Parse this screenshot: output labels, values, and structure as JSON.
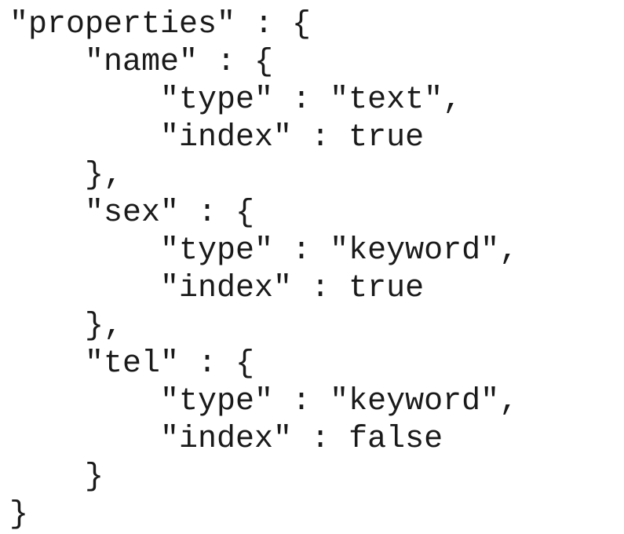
{
  "code": {
    "lines": [
      "\"properties\" : {",
      "    \"name\" : {",
      "        \"type\" : \"text\",",
      "        \"index\" : true",
      "    },",
      "    \"sex\" : {",
      "        \"type\" : \"keyword\",",
      "        \"index\" : true",
      "    },",
      "    \"tel\" : {",
      "        \"type\" : \"keyword\",",
      "        \"index\" : false",
      "    }",
      "}"
    ]
  }
}
